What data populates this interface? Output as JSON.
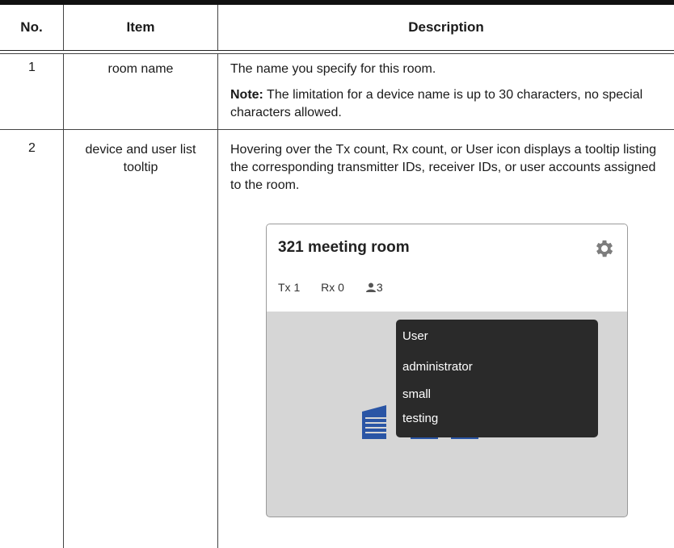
{
  "table": {
    "headers": [
      "No.",
      "Item",
      "Description"
    ],
    "rows": [
      {
        "no": "1",
        "item": "room name",
        "description": "The name you specify for this room.",
        "note_label": "Note:",
        "note_text": "The limitation for a device name is up to 30 characters, no special characters allowed."
      },
      {
        "no": "2",
        "item": "device and user list tooltip",
        "description": "Hovering over the Tx count, Rx count, or User icon displays a tooltip listing the corresponding transmitter IDs, receiver IDs, or user accounts assigned to the room."
      }
    ]
  },
  "card": {
    "title": "321 meeting room",
    "tx": "Tx 1",
    "rx": "Rx 0",
    "users": "3",
    "icons": [
      "gear-icon",
      "user-icon"
    ],
    "tooltip": {
      "heading": "User",
      "items": [
        "administrator",
        "small",
        "testing"
      ]
    }
  }
}
